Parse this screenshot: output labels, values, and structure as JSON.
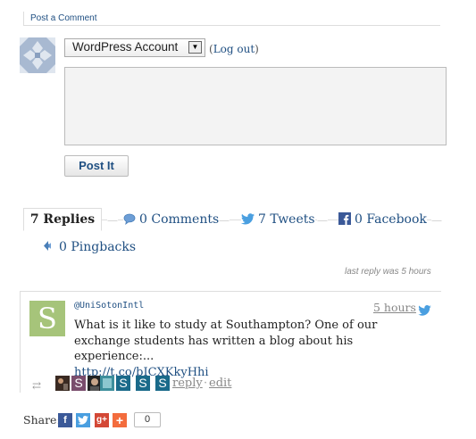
{
  "comment_form": {
    "title": "Post a Comment",
    "account_select_value": "WordPress Account",
    "logout_open": "(",
    "logout_label": "Log out",
    "logout_close": ")",
    "textarea_value": "",
    "post_button_label": "Post It"
  },
  "tabs": {
    "replies": "7 Replies",
    "comments": "0 Comments",
    "tweets": "7 Tweets",
    "facebook": "0 Facebook",
    "pingbacks": "0 Pingbacks"
  },
  "last_reply": "last reply was 5 hours",
  "tweet": {
    "user": "@UniSotonIntl",
    "time": "5 hours",
    "text": "What is it like to study at Southampton? One of our exchange students has written a blog about his experience:...",
    "link": "http://t.co/bICXKkyHhi",
    "avatar_letter": "S",
    "reply_label": "reply",
    "separator": "·",
    "edit_label": "edit",
    "retweeter_letters": [
      "",
      "S",
      "",
      "S",
      "S",
      "S"
    ]
  },
  "share": {
    "label": "Share:",
    "count": "0"
  },
  "colors": {
    "link": "#1f4f82",
    "twitter": "#4a9fe0",
    "facebook": "#3b5998",
    "google_plus": "#d34836",
    "addthis": "#f36c3d",
    "tweet_avatar": "#a6c47a"
  }
}
